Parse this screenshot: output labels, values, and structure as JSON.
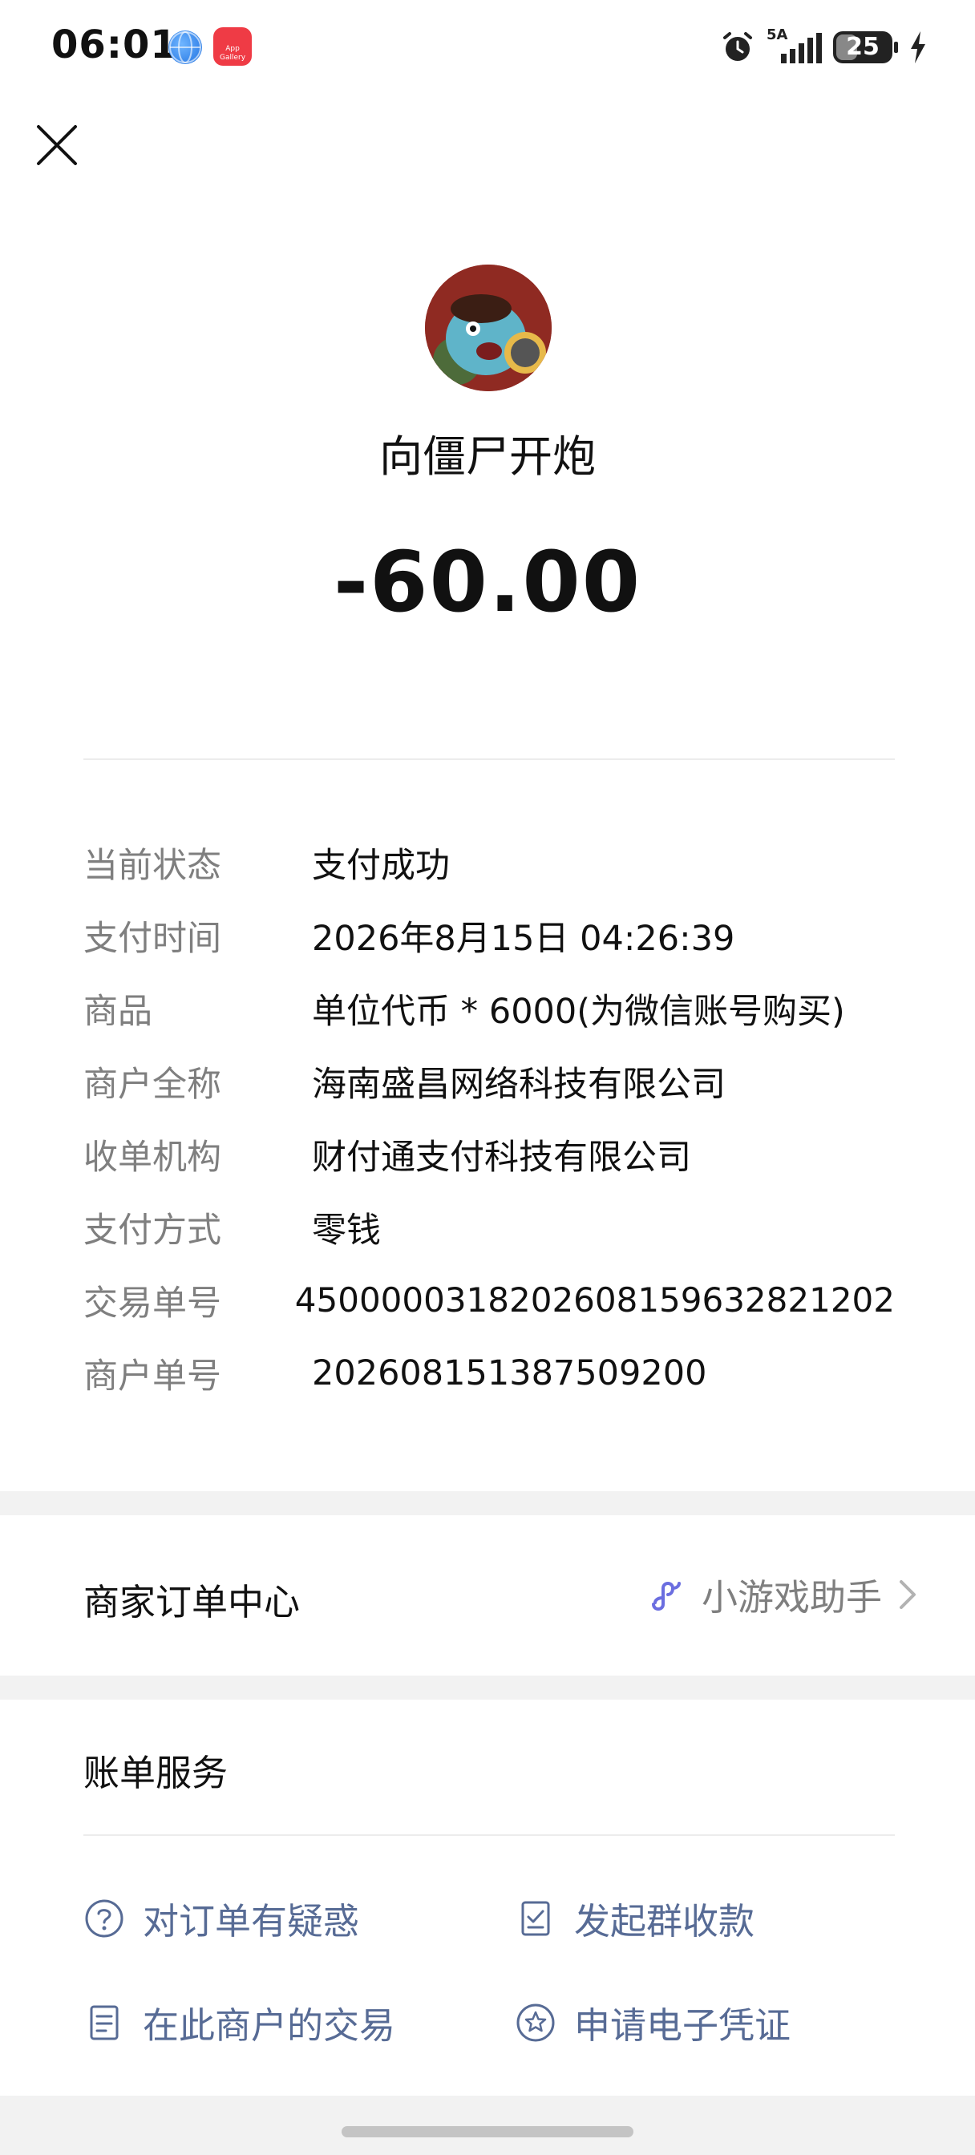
{
  "status_bar": {
    "time": "06:01",
    "app_icon_label": "App Gallery",
    "network": "5A",
    "battery": "25"
  },
  "header": {
    "merchant_name": "向僵尸开炮",
    "amount": "-60.00"
  },
  "details": [
    {
      "label": "当前状态",
      "value": "支付成功"
    },
    {
      "label": "支付时间",
      "value": "2026年8月15日 04:26:39"
    },
    {
      "label": "商品",
      "value": "单位代币 * 6000(为微信账号购买)"
    },
    {
      "label": "商户全称",
      "value": "海南盛昌网络科技有限公司"
    },
    {
      "label": "收单机构",
      "value": "财付通支付科技有限公司"
    },
    {
      "label": "支付方式",
      "value": "零钱"
    },
    {
      "label": "交易单号",
      "value": "4500000318202608159632821202"
    },
    {
      "label": "商户单号",
      "value": "202608151387509200"
    }
  ],
  "order_center": {
    "label": "商家订单中心",
    "link_label": "小游戏助手"
  },
  "bill_services": {
    "title": "账单服务",
    "items": [
      {
        "label": "对订单有疑惑",
        "icon": "question-circle-icon"
      },
      {
        "label": "发起群收款",
        "icon": "checklist-doc-icon"
      },
      {
        "label": "在此商户的交易",
        "icon": "document-icon"
      },
      {
        "label": "申请电子凭证",
        "icon": "star-circle-icon"
      }
    ]
  },
  "colors": {
    "link": "#576b95",
    "label_gray": "#7f7f7f",
    "separator": "#f2f2f2"
  }
}
